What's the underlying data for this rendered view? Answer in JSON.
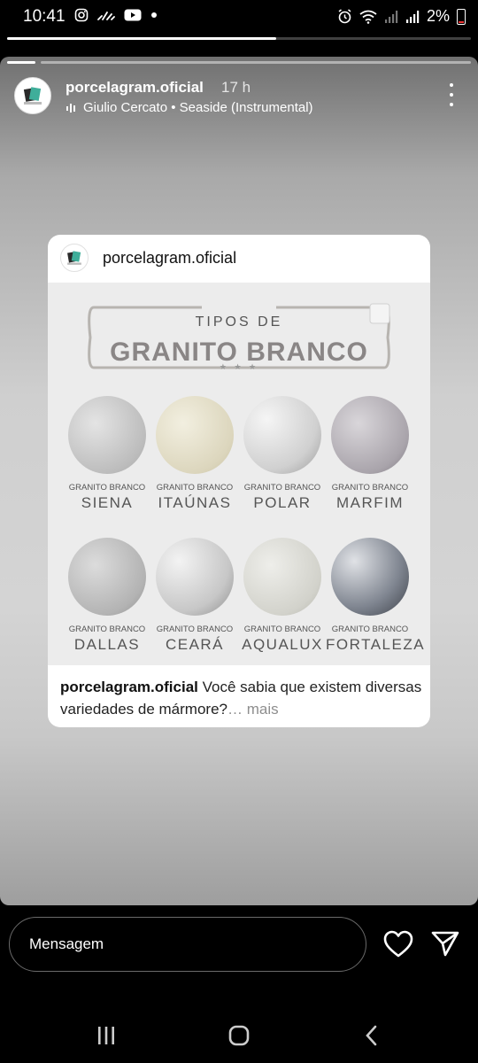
{
  "status_bar": {
    "time": "10:41",
    "battery": "2%",
    "left_icons": [
      "instagram-icon",
      "signal-activity-icon",
      "youtube-icon",
      "notification-dot-icon"
    ],
    "right_icons": [
      "alarm-icon",
      "wifi-icon",
      "signal-icon",
      "signal-icon",
      "battery-icon"
    ]
  },
  "progress": {
    "fraction": 0.58
  },
  "story": {
    "username": "porcelagram.oficial",
    "time_ago": "17 h",
    "music": "Giulio Cercato • Seaside (Instrumental)"
  },
  "post": {
    "username": "porcelagram.oficial",
    "banner_top": "TIPOS DE",
    "banner_main": "GRANITO BRANCO",
    "banner_stars": "★ ★ ★",
    "stone_prefix": "GRANITO BRANCO",
    "stones": [
      {
        "name": "SIENA"
      },
      {
        "name": "ITAÚNAS"
      },
      {
        "name": "POLAR"
      },
      {
        "name": "MARFIM"
      },
      {
        "name": "DALLAS"
      },
      {
        "name": "CEARÁ"
      },
      {
        "name": "AQUALUX"
      },
      {
        "name": "FORTALEZA"
      }
    ],
    "caption_user": "porcelagram.oficial",
    "caption_text": "Você sabia que existem diversas variedades de mármore?",
    "caption_more": "… mais"
  },
  "bottom": {
    "message_placeholder": "Mensagem"
  },
  "colors": {
    "background": "#000000",
    "card": "#ffffff",
    "muted_text": "#8e8e8e"
  }
}
